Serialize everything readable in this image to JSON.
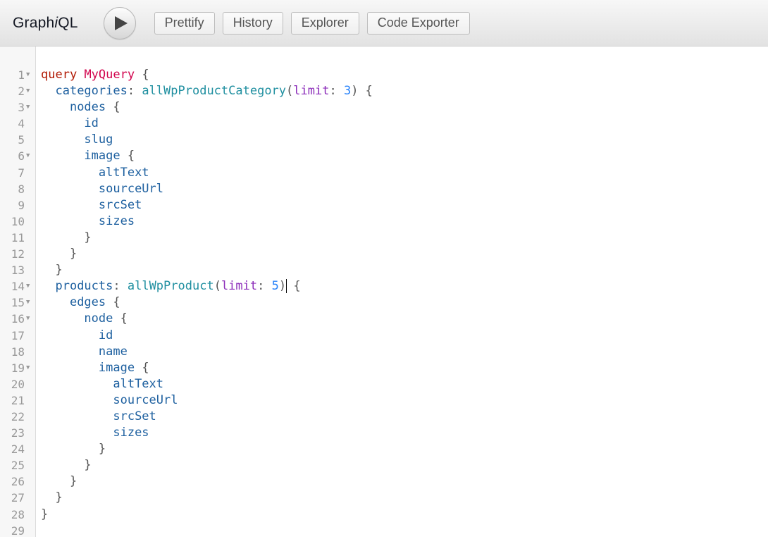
{
  "toolbar": {
    "title_prefix": "Graph",
    "title_italic": "i",
    "title_suffix": "QL",
    "run_icon": "play-icon",
    "buttons": [
      "Prettify",
      "History",
      "Explorer",
      "Code Exporter"
    ]
  },
  "editor": {
    "lines": [
      {
        "n": "1",
        "fold": true,
        "tokens": [
          [
            "kw",
            "query"
          ],
          [
            "punc",
            " "
          ],
          [
            "def",
            "MyQuery"
          ],
          [
            "punc",
            " {"
          ]
        ]
      },
      {
        "n": "2",
        "fold": true,
        "tokens": [
          [
            "punc",
            "  "
          ],
          [
            "prop",
            "categories"
          ],
          [
            "punc",
            ": "
          ],
          [
            "fn",
            "allWpProductCategory"
          ],
          [
            "punc",
            "("
          ],
          [
            "attr",
            "limit"
          ],
          [
            "punc",
            ": "
          ],
          [
            "num",
            "3"
          ],
          [
            "punc",
            ") {"
          ]
        ]
      },
      {
        "n": "3",
        "fold": true,
        "tokens": [
          [
            "punc",
            "    "
          ],
          [
            "prop",
            "nodes"
          ],
          [
            "punc",
            " {"
          ]
        ]
      },
      {
        "n": "4",
        "fold": false,
        "tokens": [
          [
            "punc",
            "      "
          ],
          [
            "prop",
            "id"
          ]
        ]
      },
      {
        "n": "5",
        "fold": false,
        "tokens": [
          [
            "punc",
            "      "
          ],
          [
            "prop",
            "slug"
          ]
        ]
      },
      {
        "n": "6",
        "fold": true,
        "tokens": [
          [
            "punc",
            "      "
          ],
          [
            "prop",
            "image"
          ],
          [
            "punc",
            " {"
          ]
        ]
      },
      {
        "n": "7",
        "fold": false,
        "tokens": [
          [
            "punc",
            "        "
          ],
          [
            "prop",
            "altText"
          ]
        ]
      },
      {
        "n": "8",
        "fold": false,
        "tokens": [
          [
            "punc",
            "        "
          ],
          [
            "prop",
            "sourceUrl"
          ]
        ]
      },
      {
        "n": "9",
        "fold": false,
        "tokens": [
          [
            "punc",
            "        "
          ],
          [
            "prop",
            "srcSet"
          ]
        ]
      },
      {
        "n": "10",
        "fold": false,
        "tokens": [
          [
            "punc",
            "        "
          ],
          [
            "prop",
            "sizes"
          ]
        ]
      },
      {
        "n": "11",
        "fold": false,
        "tokens": [
          [
            "punc",
            "      }"
          ]
        ]
      },
      {
        "n": "12",
        "fold": false,
        "tokens": [
          [
            "punc",
            "    }"
          ]
        ]
      },
      {
        "n": "13",
        "fold": false,
        "tokens": [
          [
            "punc",
            "  }"
          ]
        ]
      },
      {
        "n": "14",
        "fold": true,
        "tokens": [
          [
            "punc",
            "  "
          ],
          [
            "prop",
            "products"
          ],
          [
            "punc",
            ": "
          ],
          [
            "fn",
            "allWpProduct"
          ],
          [
            "punc",
            "("
          ],
          [
            "attr",
            "limit"
          ],
          [
            "punc",
            ": "
          ],
          [
            "num",
            "5"
          ],
          [
            "punc",
            ")"
          ],
          [
            "cursor",
            ""
          ],
          [
            "punc",
            " {"
          ]
        ]
      },
      {
        "n": "15",
        "fold": true,
        "tokens": [
          [
            "punc",
            "    "
          ],
          [
            "prop",
            "edges"
          ],
          [
            "punc",
            " {"
          ]
        ]
      },
      {
        "n": "16",
        "fold": true,
        "tokens": [
          [
            "punc",
            "      "
          ],
          [
            "prop",
            "node"
          ],
          [
            "punc",
            " {"
          ]
        ]
      },
      {
        "n": "17",
        "fold": false,
        "tokens": [
          [
            "punc",
            "        "
          ],
          [
            "prop",
            "id"
          ]
        ]
      },
      {
        "n": "18",
        "fold": false,
        "tokens": [
          [
            "punc",
            "        "
          ],
          [
            "prop",
            "name"
          ]
        ]
      },
      {
        "n": "19",
        "fold": true,
        "tokens": [
          [
            "punc",
            "        "
          ],
          [
            "prop",
            "image"
          ],
          [
            "punc",
            " {"
          ]
        ]
      },
      {
        "n": "20",
        "fold": false,
        "tokens": [
          [
            "punc",
            "          "
          ],
          [
            "prop",
            "altText"
          ]
        ]
      },
      {
        "n": "21",
        "fold": false,
        "tokens": [
          [
            "punc",
            "          "
          ],
          [
            "prop",
            "sourceUrl"
          ]
        ]
      },
      {
        "n": "22",
        "fold": false,
        "tokens": [
          [
            "punc",
            "          "
          ],
          [
            "prop",
            "srcSet"
          ]
        ]
      },
      {
        "n": "23",
        "fold": false,
        "tokens": [
          [
            "punc",
            "          "
          ],
          [
            "prop",
            "sizes"
          ]
        ]
      },
      {
        "n": "24",
        "fold": false,
        "tokens": [
          [
            "punc",
            "        }"
          ]
        ]
      },
      {
        "n": "25",
        "fold": false,
        "tokens": [
          [
            "punc",
            "      }"
          ]
        ]
      },
      {
        "n": "26",
        "fold": false,
        "tokens": [
          [
            "punc",
            "    }"
          ]
        ]
      },
      {
        "n": "27",
        "fold": false,
        "tokens": [
          [
            "punc",
            "  }"
          ]
        ]
      },
      {
        "n": "28",
        "fold": false,
        "tokens": [
          [
            "punc",
            "}"
          ]
        ]
      },
      {
        "n": "29",
        "fold": false,
        "tokens": []
      }
    ]
  }
}
